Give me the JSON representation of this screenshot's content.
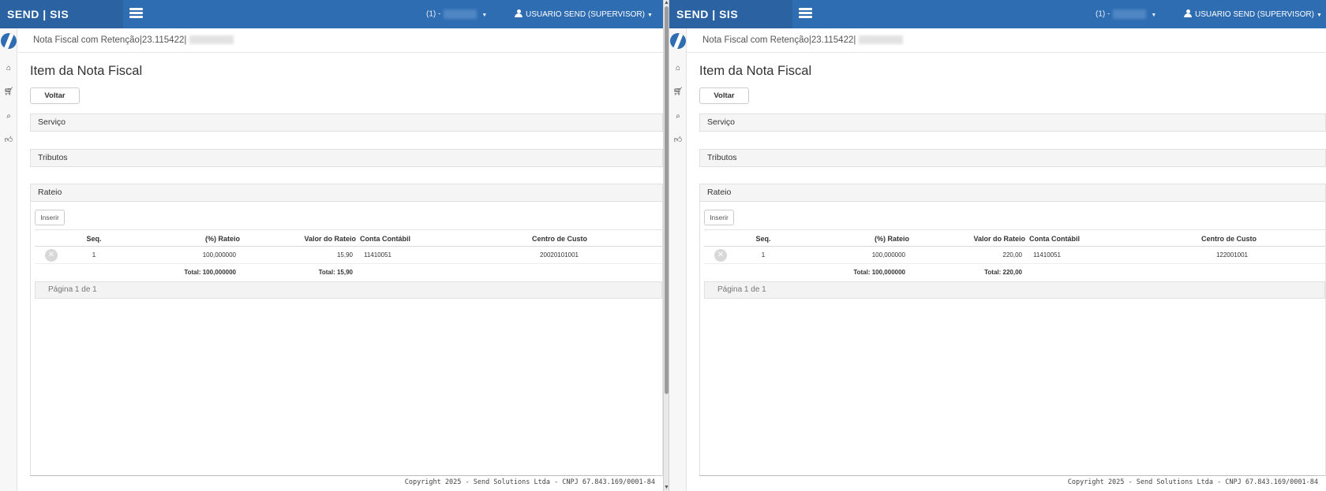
{
  "header": {
    "brand": "SEND | SIS",
    "company_prefix": "(1) -",
    "user_label": "USUARIO SEND (SUPERVISOR)"
  },
  "sidebar": {
    "icons": [
      "home-icon",
      "shopping-cart-icon",
      "search-icon",
      "thumbs-up-icon"
    ]
  },
  "page": {
    "breadcrumb": "Nota Fiscal com Retenção|23.115422|",
    "title": "Item da Nota Fiscal",
    "back_label": "Voltar",
    "sections": {
      "servico": "Serviço",
      "tributos": "Tributos",
      "rateio": "Rateio"
    },
    "insert_label": "Inserir",
    "columns": {
      "seq": "Seq.",
      "rateio": "(%) Rateio",
      "valor": "Valor do Rateio",
      "conta": "Conta Contábil",
      "centro": "Centro de Custo"
    },
    "pagination": "Página 1 de 1",
    "copyright": "Copyright 2025 - Send Solutions Ltda - CNPJ 67.843.169/0001-84"
  },
  "left": {
    "row": {
      "seq": "1",
      "rateio": "100,000000",
      "valor": "15,90",
      "conta": "11410051",
      "centro": "20020101001"
    },
    "total_rateio": "Total: 100,000000",
    "total_valor": "Total: 15,90"
  },
  "right": {
    "row": {
      "seq": "1",
      "rateio": "100,000000",
      "valor": "220,00",
      "conta": "11410051",
      "centro": "122001001"
    },
    "total_rateio": "Total: 100,000000",
    "total_valor": "Total: 220,00"
  }
}
